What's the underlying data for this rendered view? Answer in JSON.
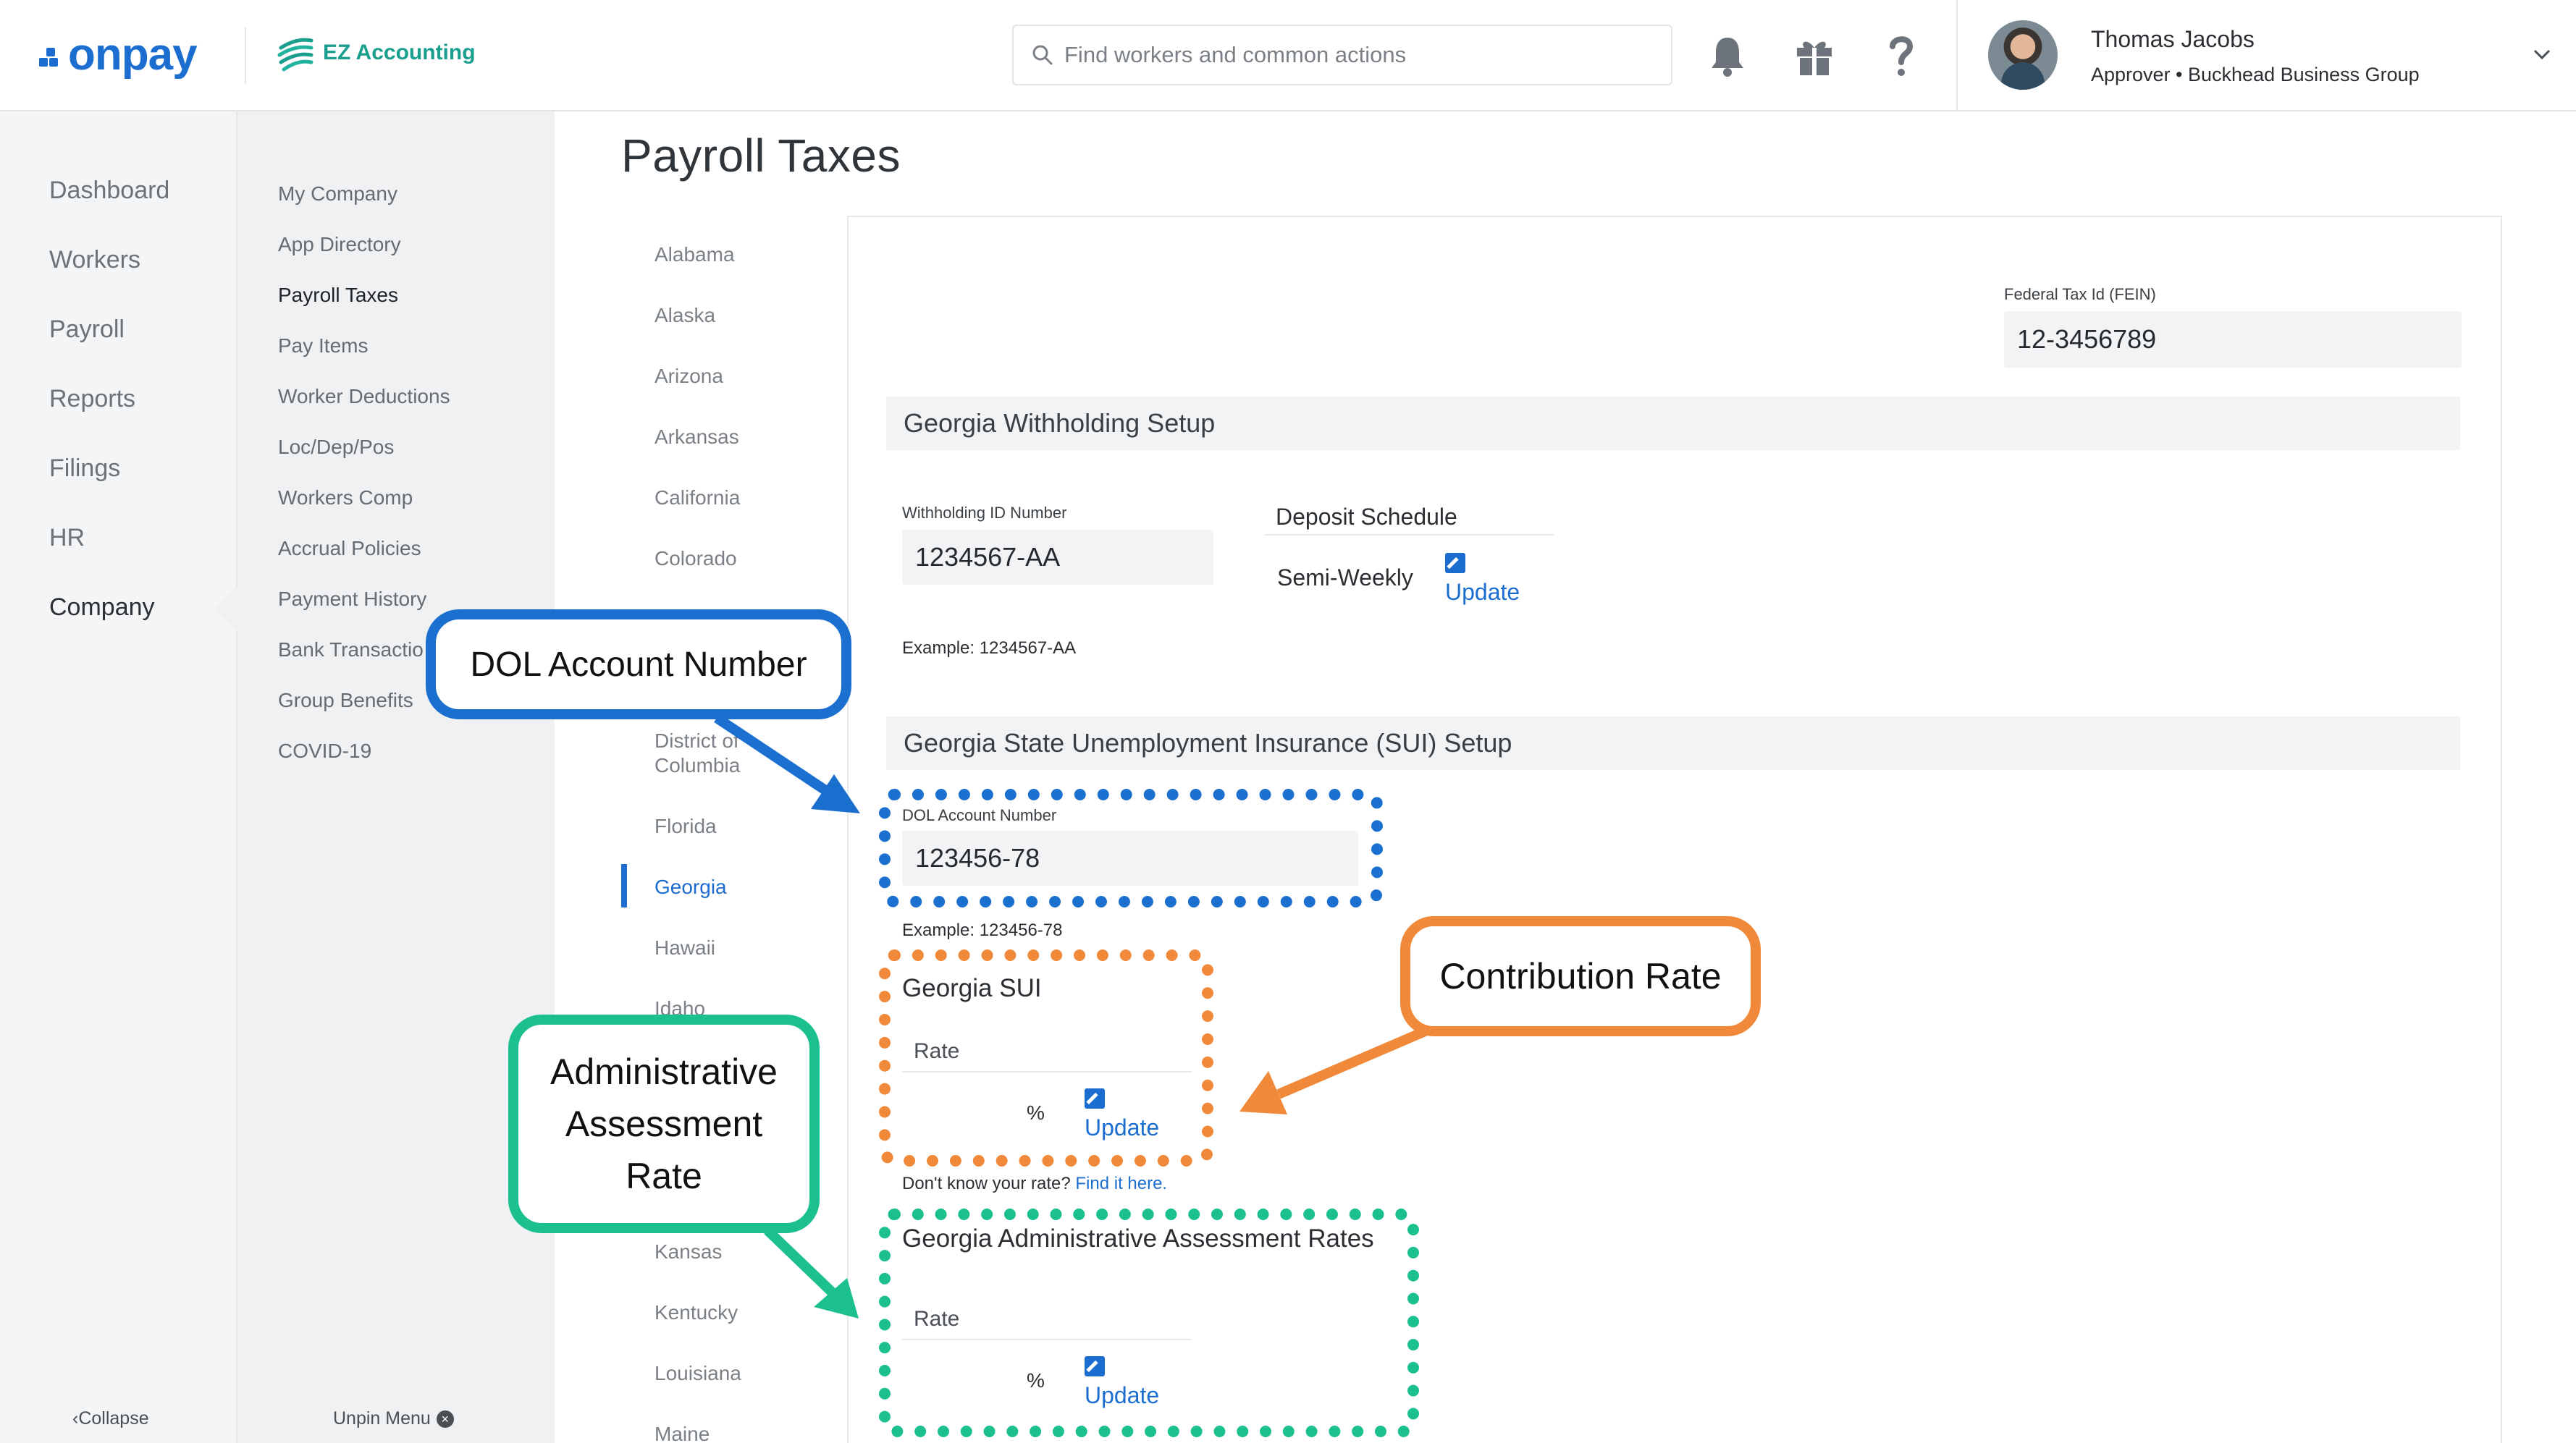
{
  "header": {
    "brand": "onpay",
    "app_brand": "EZ Accounting",
    "search_placeholder": "Find workers and common actions",
    "user_name": "Thomas Jacobs",
    "user_role": "Approver • Buckhead Business Group",
    "icons": [
      "bell-icon",
      "gift-icon",
      "help-icon",
      "chevron-down-icon"
    ]
  },
  "leftnav": {
    "items": [
      {
        "label": "Dashboard"
      },
      {
        "label": "Workers"
      },
      {
        "label": "Payroll"
      },
      {
        "label": "Reports"
      },
      {
        "label": "Filings"
      },
      {
        "label": "HR"
      },
      {
        "label": "Company"
      }
    ],
    "active": "Company",
    "collapse_label": "Collapse"
  },
  "subnav": {
    "items": [
      {
        "label": "My Company"
      },
      {
        "label": "App Directory"
      },
      {
        "label": "Payroll Taxes"
      },
      {
        "label": "Pay Items"
      },
      {
        "label": "Worker Deductions"
      },
      {
        "label": "Loc/Dep/Pos"
      },
      {
        "label": "Workers Comp"
      },
      {
        "label": "Accrual Policies"
      },
      {
        "label": "Payment History"
      },
      {
        "label": "Bank Transactio"
      },
      {
        "label": "Group Benefits"
      },
      {
        "label": "COVID-19"
      }
    ],
    "active": "Payroll Taxes",
    "unpin_label": "Unpin Menu"
  },
  "page": {
    "title": "Payroll Taxes",
    "states": [
      {
        "label": "Alabama"
      },
      {
        "label": "Alaska"
      },
      {
        "label": "Arizona"
      },
      {
        "label": "Arkansas"
      },
      {
        "label": "California"
      },
      {
        "label": "Colorado"
      },
      {
        "label": "District of"
      },
      {
        "label": "Columbia"
      },
      {
        "label": "Florida"
      },
      {
        "label": "Georgia"
      },
      {
        "label": "Hawaii"
      },
      {
        "label": "Idaho"
      },
      {
        "label": "Kansas"
      },
      {
        "label": "Kentucky"
      },
      {
        "label": "Louisiana"
      },
      {
        "label": "Maine"
      }
    ],
    "active_state": "Georgia"
  },
  "form": {
    "fein_label": "Federal Tax Id (FEIN)",
    "fein_value": "12-3456789",
    "withholding_section": "Georgia Withholding Setup",
    "withholding_id_label": "Withholding ID Number",
    "withholding_id_value": "1234567-AA",
    "withholding_example": "Example: 1234567-AA",
    "deposit_schedule_label": "Deposit Schedule",
    "deposit_schedule_value": "Semi-Weekly",
    "update_label": "Update",
    "sui_section": "Georgia State Unemployment Insurance (SUI) Setup",
    "dol_label": "DOL Account Number",
    "dol_value": "123456-78",
    "dol_example": "Example: 123456-78",
    "sui_title": "Georgia SUI",
    "rate_label": "Rate",
    "percent": "%",
    "dont_know": "Don't know your rate?",
    "find_it": "Find it here.",
    "admin_title": "Georgia Administrative Assessment Rates"
  },
  "annotations": {
    "dol_callout": "DOL Account Number",
    "contribution_callout": "Contribution Rate",
    "admin_callout_lines": [
      "Administrative",
      "Assessment",
      "Rate"
    ],
    "colors": {
      "blue": "#1b6fcf",
      "orange": "#f08a3a",
      "teal": "#1cc08e"
    }
  }
}
